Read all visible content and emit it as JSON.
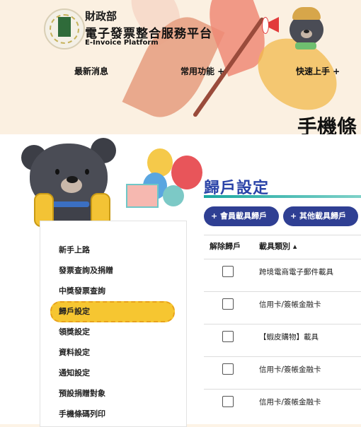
{
  "brand": {
    "ministry": "財政部",
    "platform_name": "電子發票整合服務平台",
    "platform_en": "E-Invoice Platform"
  },
  "nav": {
    "items": [
      {
        "label": "最新消息"
      },
      {
        "label": "常用功能 +"
      },
      {
        "label": "快速上手 +"
      }
    ]
  },
  "page": {
    "title": "手機條"
  },
  "sidebar": {
    "items": [
      {
        "label": "新手上路"
      },
      {
        "label": "發票查詢及捐贈"
      },
      {
        "label": "中獎發票查詢"
      },
      {
        "label": "歸戶設定",
        "active": true
      },
      {
        "label": "領獎設定"
      },
      {
        "label": "資料設定"
      },
      {
        "label": "通知設定"
      },
      {
        "label": "預設捐贈對象"
      },
      {
        "label": "手機條碼列印"
      }
    ]
  },
  "main": {
    "section_title": "歸戶設定",
    "buttons": [
      {
        "label": "+ 會員載具歸戶"
      },
      {
        "label": "+ 其他載具歸戶"
      }
    ],
    "table": {
      "headers": [
        "解除歸戶",
        "載具類別 ▴"
      ],
      "rows": [
        {
          "carrier": "跨境電商電子郵件載具",
          "checked": false
        },
        {
          "carrier": "信用卡/簽帳金融卡",
          "checked": false
        },
        {
          "carrier": "【蝦皮購物】載具",
          "checked": false
        },
        {
          "carrier": "信用卡/簽帳金融卡",
          "checked": false
        },
        {
          "carrier": "信用卡/簽帳金融卡",
          "checked": false
        }
      ]
    }
  },
  "colors": {
    "accent_blue": "#2f3f93",
    "active_yellow": "#f6c631",
    "title_blue": "#2a43a8",
    "teal_line": "#1aa7a0"
  }
}
